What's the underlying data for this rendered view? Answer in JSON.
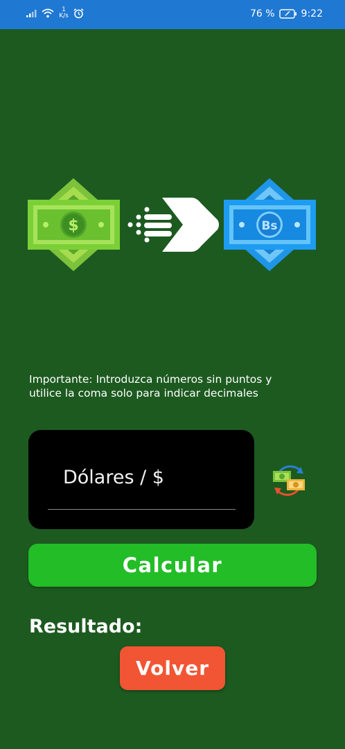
{
  "status_bar": {
    "net_speed_value": "1",
    "net_speed_unit": "K/s",
    "battery": "76 %",
    "time": "9:22"
  },
  "hero": {
    "source_currency_icon": "dollar-bill-icon",
    "arrow_icon": "fast-arrow-icon",
    "target_currency_icon": "bolivar-bill-icon",
    "target_symbol": "Bs",
    "source_symbol": "$"
  },
  "notice": {
    "line1": "Importante: Introduzca números sin puntos y",
    "line2": "utilice la coma solo para indicar decimales"
  },
  "input": {
    "placeholder": "Dólares / $"
  },
  "swap_icon": "currency-swap-icon",
  "calculate_label": "Calcular",
  "result_label": "Resultado:",
  "back_label": "Volver",
  "colors": {
    "background": "#1d5a20",
    "status_bar": "#1f78d2",
    "calculate_button": "#23bd27",
    "back_button": "#f25533",
    "input_card": "#000000"
  }
}
